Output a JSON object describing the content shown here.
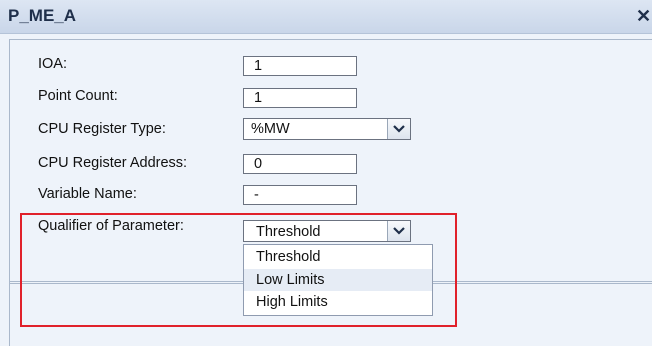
{
  "window": {
    "title": "P_ME_A",
    "close_glyph": "✕"
  },
  "form": {
    "ioa": {
      "label": "IOA:",
      "value": "1"
    },
    "point_count": {
      "label": "Point Count:",
      "value": "1"
    },
    "cpu_register_type": {
      "label": "CPU Register Type:",
      "value": "%MW"
    },
    "cpu_register_address": {
      "label": "CPU Register Address:",
      "value": "0"
    },
    "variable_name": {
      "label": "Variable Name:",
      "value": "-"
    },
    "qualifier": {
      "label": "Qualifier of Parameter:",
      "value": "Threshold",
      "options": [
        "Threshold",
        "Low Limits",
        "High Limits"
      ],
      "hovered_option": "Low Limits"
    }
  },
  "colors": {
    "highlight_border": "#e0202a",
    "title_bar": "#c9d6e9",
    "panel_background": "#eef3fa"
  }
}
